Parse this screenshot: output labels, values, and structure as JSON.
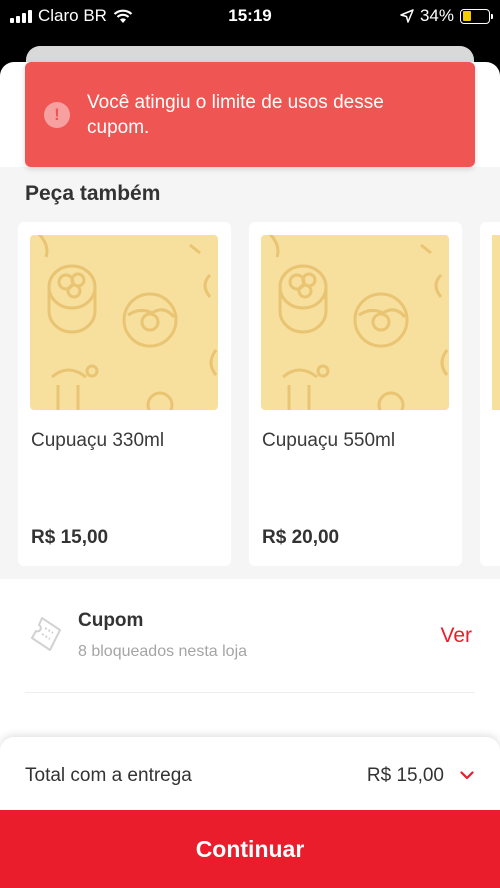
{
  "status_bar": {
    "carrier": "Claro BR",
    "time": "15:19",
    "battery": "34%",
    "battery_level": 0.34
  },
  "toast": {
    "icon": "alert-icon",
    "message": "Você atingiu o limite de usos desse cupom."
  },
  "upsell": {
    "title": "Peça também",
    "items": [
      {
        "name": "Cupuaçu 330ml",
        "price": "R$ 15,00"
      },
      {
        "name": "Cupuaçu 550ml",
        "price": "R$ 20,00"
      }
    ]
  },
  "coupon": {
    "icon": "ticket-icon",
    "title": "Cupom",
    "subtitle": "8 bloqueados nesta loja",
    "action": "Ver"
  },
  "footer": {
    "total_label": "Total com a entrega",
    "total_value": "R$ 15,00",
    "continue_label": "Continuar"
  },
  "colors": {
    "brand": "#ea1d2c",
    "toast": "#ef5552",
    "placeholder": "#f7df9e"
  }
}
